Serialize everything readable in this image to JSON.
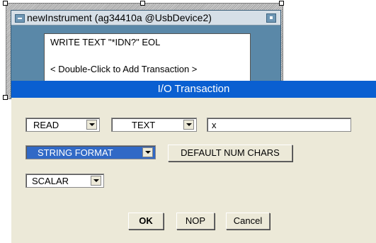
{
  "instrument_object": {
    "title": "newInstrument (ag34410a @UsbDevice2)",
    "transactions": [
      "WRITE TEXT \"*IDN?\" EOL",
      "< Double-Click to Add Transaction >"
    ]
  },
  "dialog": {
    "title": "I/O Transaction",
    "action_value": "READ",
    "encoding_value": "TEXT",
    "variable_value": "x",
    "format_value": "STRING FORMAT",
    "default_num_chars_label": "DEFAULT NUM CHARS",
    "shape_value": "SCALAR",
    "ok_label": "OK",
    "nop_label": "NOP",
    "cancel_label": "Cancel"
  },
  "colors": {
    "dialog_title_bar": "#0a5fd1",
    "selection": "#3169c6",
    "dialog_background": "#ece9d8",
    "object_frame": "#5a88a8"
  },
  "icons": {
    "minimize": "minimize-icon",
    "maximize": "maximize-icon",
    "dropdown": "chevron-down-icon"
  }
}
